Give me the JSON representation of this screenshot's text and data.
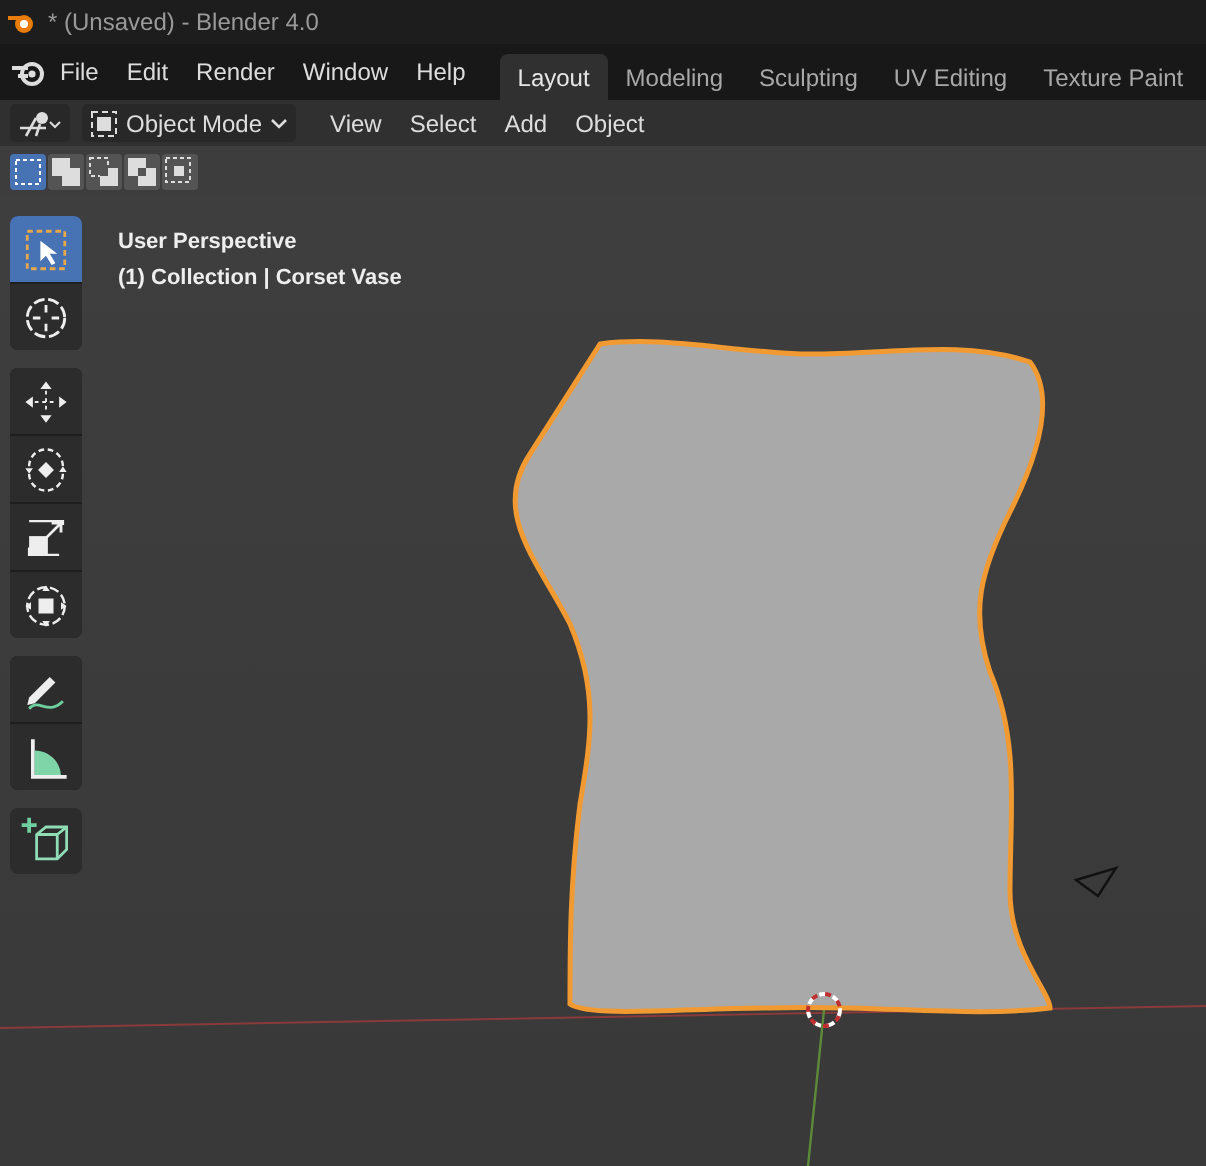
{
  "window": {
    "title": "* (Unsaved) - Blender 4.0"
  },
  "menu": [
    "File",
    "Edit",
    "Render",
    "Window",
    "Help"
  ],
  "workspace_tabs": [
    {
      "label": "Layout",
      "selected": true
    },
    {
      "label": "Modeling",
      "selected": false
    },
    {
      "label": "Sculpting",
      "selected": false
    },
    {
      "label": "UV Editing",
      "selected": false
    },
    {
      "label": "Texture Paint",
      "selected": false
    }
  ],
  "header": {
    "mode": "Object Mode",
    "menus": [
      "View",
      "Select",
      "Add",
      "Object"
    ]
  },
  "select_modes": [
    {
      "kind": "new",
      "selected": true
    },
    {
      "kind": "extend",
      "selected": false
    },
    {
      "kind": "subtract",
      "selected": false
    },
    {
      "kind": "difference",
      "selected": false
    },
    {
      "kind": "intersect",
      "selected": false
    }
  ],
  "tool_groups": [
    {
      "tools": [
        {
          "kind": "select",
          "selected": true
        },
        {
          "kind": "cursor",
          "selected": false
        }
      ]
    },
    {
      "tools": [
        {
          "kind": "move",
          "selected": false
        },
        {
          "kind": "rotate",
          "selected": false
        },
        {
          "kind": "scale",
          "selected": false
        },
        {
          "kind": "transform",
          "selected": false
        }
      ]
    },
    {
      "tools": [
        {
          "kind": "annotate",
          "selected": false
        },
        {
          "kind": "measure",
          "selected": false
        }
      ]
    },
    {
      "tools": [
        {
          "kind": "add-cube",
          "selected": false
        }
      ]
    }
  ],
  "viewport": {
    "view_name": "User Perspective",
    "object_info": "(1) Collection | Corset Vase"
  }
}
